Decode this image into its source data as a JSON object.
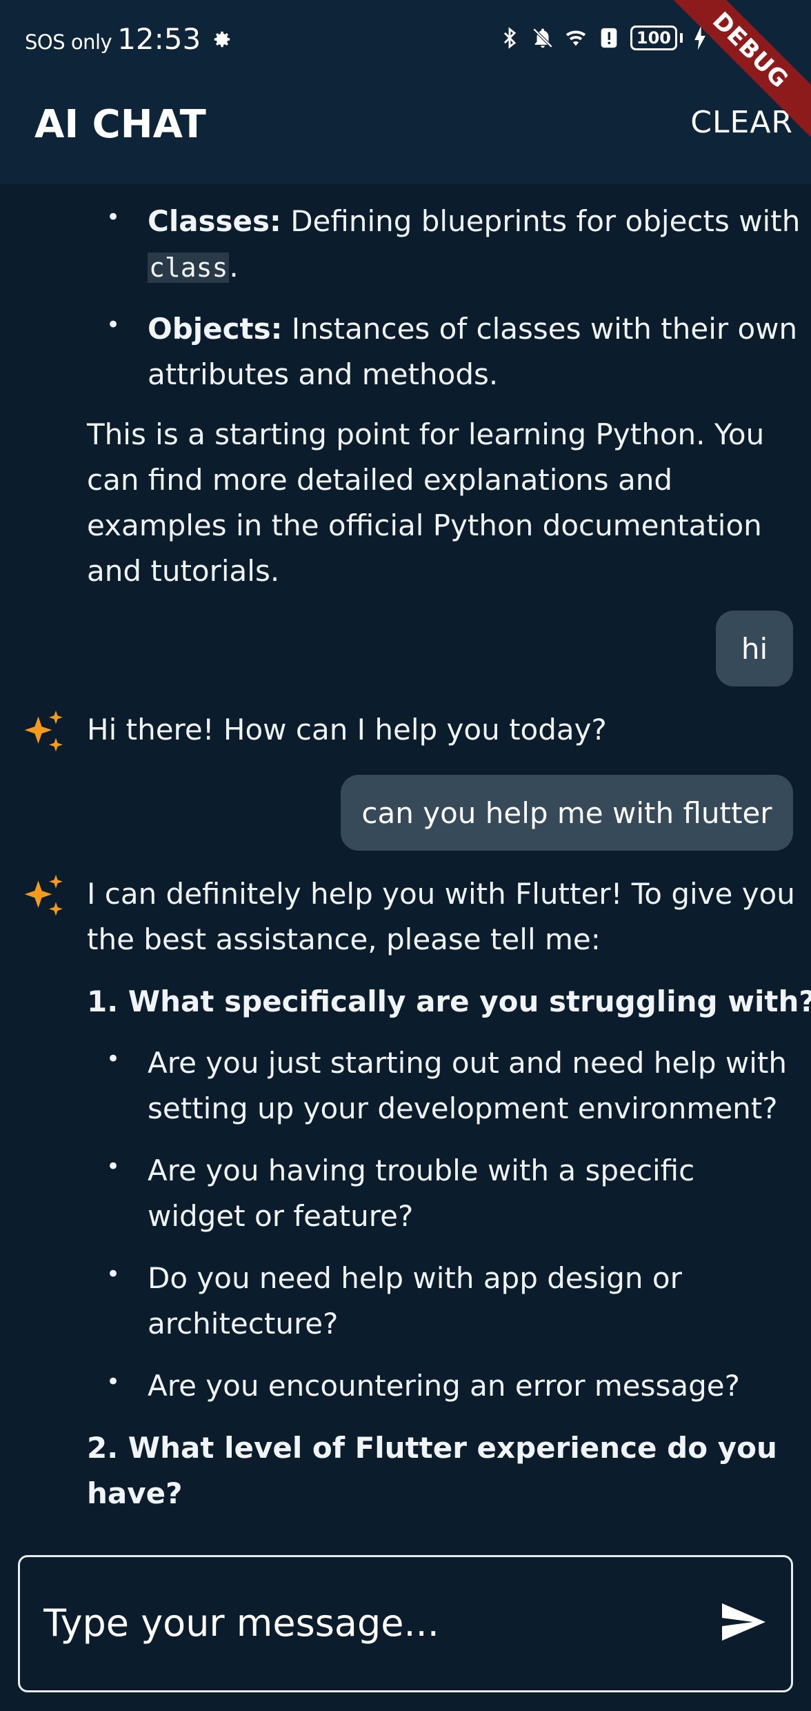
{
  "status_bar": {
    "carrier": "SOS only",
    "time": "12:53",
    "battery": "100",
    "icons": [
      "gear-icon",
      "bluetooth-icon",
      "bell-muted-icon",
      "wifi-icon",
      "alert-icon",
      "battery-icon",
      "charging-icon"
    ]
  },
  "debug_banner": "DEBUG",
  "app_bar": {
    "title": "AI CHAT",
    "clear_label": "CLEAR"
  },
  "messages": {
    "prev_ai": {
      "bullet1_bold": "Classes:",
      "bullet1_text": " Defining blueprints for objects with",
      "bullet1_code": "class",
      "bullet1_tail": ".",
      "bullet2_bold": "Objects:",
      "bullet2_text": " Instances of classes with their own",
      "bullet2_line2": "attributes and methods.",
      "para_lines": [
        "This is a starting point for learning Python. You",
        "can find more detailed explanations and",
        "examples in the official Python documentation",
        "and tutorials."
      ]
    },
    "user1": "hi",
    "ai1": "Hi there! How can I help you today?",
    "user2": "can you help me with flutter",
    "ai2": {
      "intro_lines": [
        "I can definitely help you with Flutter! To give you",
        "the best assistance, please tell me:"
      ],
      "heading1": "1. What specifically are you struggling with?",
      "bullets": [
        [
          "Are you just starting out and need help with",
          "setting up your development environment?"
        ],
        [
          "Are you having trouble with a specific",
          "widget or feature?"
        ],
        [
          "Do you need help with app design or",
          "architecture?"
        ],
        [
          "Are you encountering an error message?"
        ]
      ],
      "heading2_lines": [
        "2. What level of Flutter experience do you",
        "have?"
      ]
    }
  },
  "input": {
    "placeholder": "Type your message..."
  },
  "colors": {
    "background": "#0b1c2d",
    "app_bar": "#0e2438",
    "user_bubble": "#374a59",
    "ai_icon": "#f49a1e",
    "debug": "#8e1b1b"
  }
}
